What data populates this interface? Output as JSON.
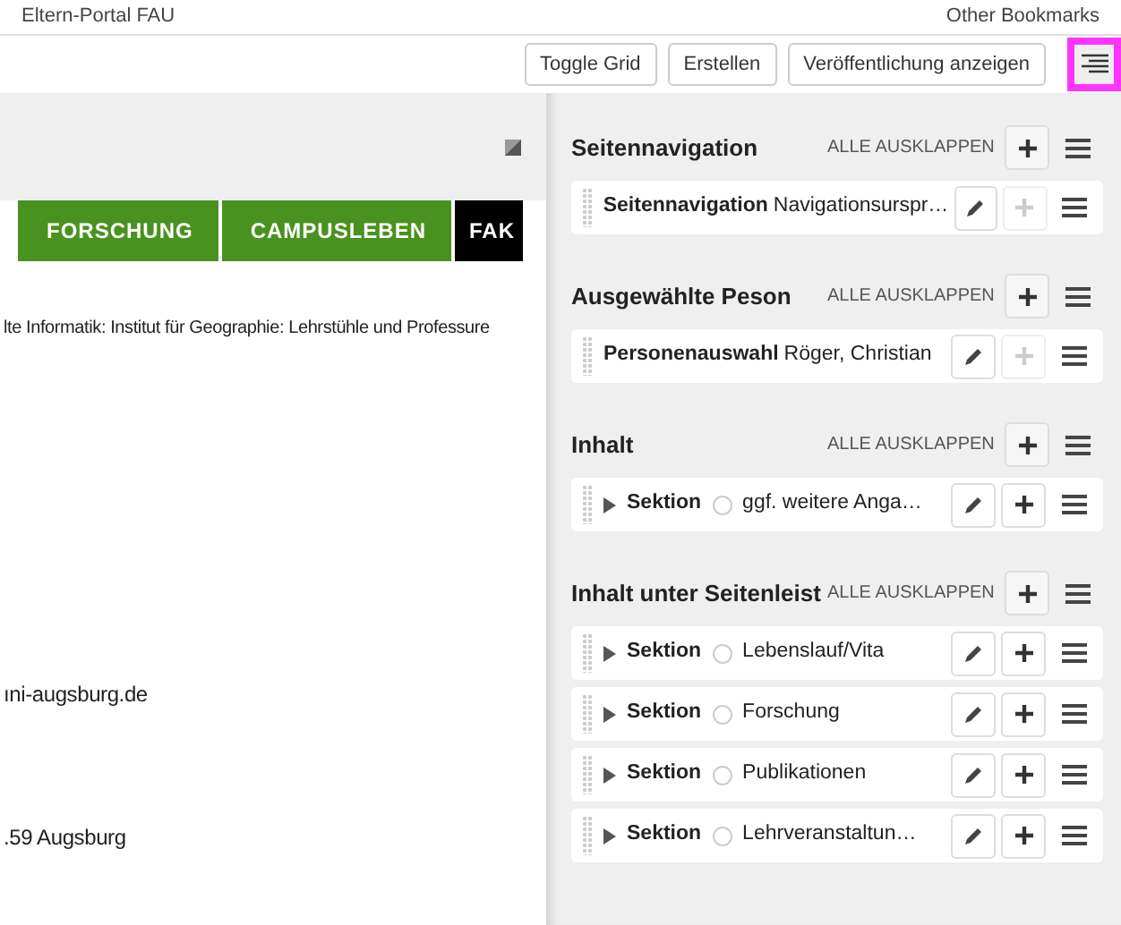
{
  "bookmarks": [
    {
      "label": "Eltern-Portal FAU"
    },
    {
      "label": "Other Bookmarks"
    }
  ],
  "toolbar": {
    "buttons": [
      "Toggle Grid",
      "Erstellen",
      "Veröffentlichung anzeigen"
    ],
    "panel_toggle": {
      "highlighted": true
    }
  },
  "site": {
    "nav": [
      {
        "label": "FORSCHUNG",
        "selected": false
      },
      {
        "label": "CAMPUSLEBEN",
        "selected": false
      },
      {
        "label": "FAK",
        "selected": true
      }
    ],
    "breadcrumb": "lte Informatik: Institut für Geographie: Lehrstühle und Professure",
    "email": "ıni-augsburg.de",
    "address": ".59 Augsburg"
  },
  "panel": {
    "groups": [
      {
        "title": "Seitennavigation",
        "expand_all": "ALLE AUSKLAPPEN",
        "items": [
          {
            "kind": "plain",
            "type": "Seitennavigation",
            "text": "Navigationsurspr…",
            "add_disabled": true
          }
        ]
      },
      {
        "title": "Ausgewählte Peson",
        "expand_all": "ALLE AUSKLAPPEN",
        "items": [
          {
            "kind": "plain",
            "type": "Personenauswahl",
            "text": "Röger, Christian",
            "add_disabled": true
          }
        ]
      },
      {
        "title": "Inhalt",
        "expand_all": "ALLE AUSKLAPPEN",
        "items": [
          {
            "kind": "section",
            "type": "Sektion",
            "text": "ggf. weitere Anga…",
            "add_disabled": false
          }
        ]
      },
      {
        "title": "Inhalt unter Seitenleist",
        "expand_all": "ALLE AUSKLAPPEN",
        "items": [
          {
            "kind": "section",
            "type": "Sektion",
            "text": "Lebenslauf/Vita",
            "add_disabled": false
          },
          {
            "kind": "section",
            "type": "Sektion",
            "text": "Forschung",
            "add_disabled": false
          },
          {
            "kind": "section",
            "type": "Sektion",
            "text": "Publikationen",
            "add_disabled": false
          },
          {
            "kind": "section",
            "type": "Sektion",
            "text": "Lehrveranstaltun…",
            "add_disabled": false
          }
        ]
      }
    ]
  }
}
